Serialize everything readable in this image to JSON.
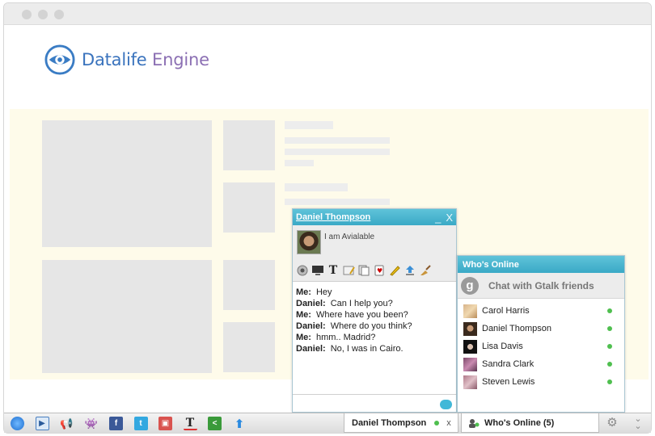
{
  "logo": {
    "part1": "Datalife",
    "part2": "Engine"
  },
  "chat": {
    "name": "Daniel Thompson",
    "minimize": "_",
    "close": "X",
    "status": "I am Avialable",
    "messages": [
      {
        "who": "Me:",
        "text": "Hey"
      },
      {
        "who": "Daniel:",
        "text": "Can I help you?"
      },
      {
        "who": "Me:",
        "text": "Where have you been?"
      },
      {
        "who": "Daniel:",
        "text": "Where do you think?"
      },
      {
        "who": "Me:",
        "text": "hmm.. Madrid?"
      },
      {
        "who": "Daniel:",
        "text": "No, I was in Cairo."
      }
    ]
  },
  "who": {
    "title": "Who's Online",
    "gtalk_label": "Chat with Gtalk friends",
    "gtalk_icon": "g",
    "friends": [
      {
        "name": "Carol Harris"
      },
      {
        "name": "Daniel Thompson"
      },
      {
        "name": "Lisa Davis"
      },
      {
        "name": "Sandra Clark"
      },
      {
        "name": "Steven Lewis"
      }
    ]
  },
  "bar": {
    "chat_tab": "Daniel Thompson",
    "chat_tab_close": "x",
    "who_tab": "Who's Online (5)"
  },
  "colors": {
    "accent": "#41b8d8",
    "online": "#4fbf4f"
  }
}
